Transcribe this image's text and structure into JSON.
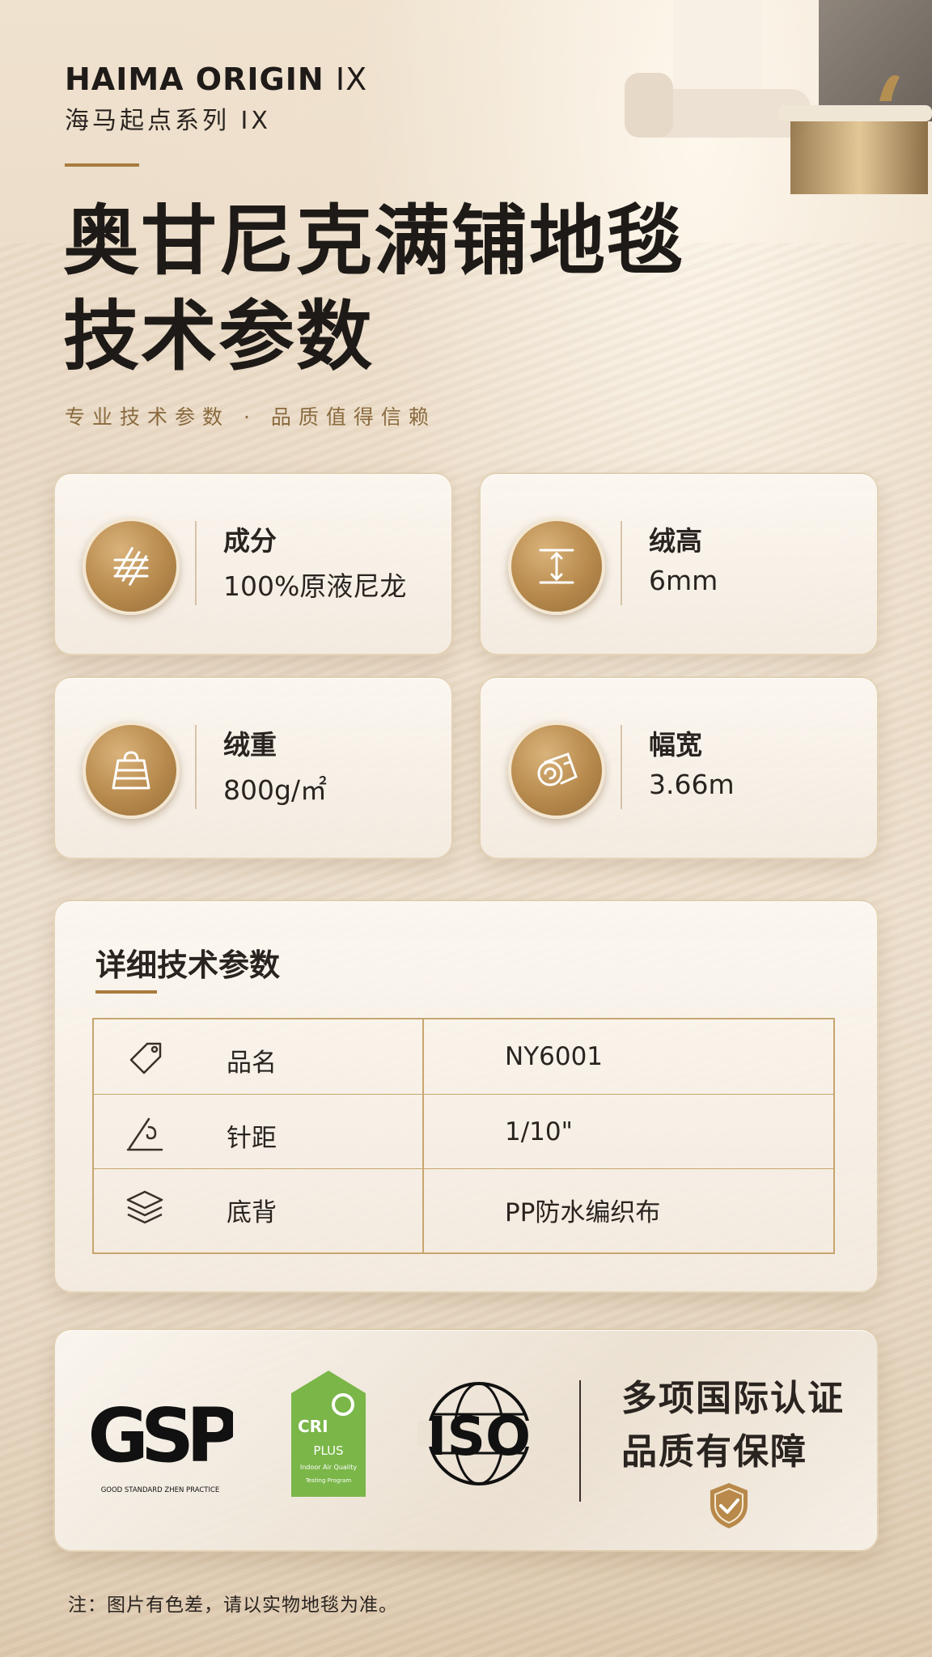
{
  "brand": {
    "name_en": "HAIMA ORIGIN",
    "series_suffix": "IX",
    "name_cn": "海马起点系列 IX"
  },
  "title": {
    "line1": "奥甘尼克满铺地毯",
    "line2": "技术参数"
  },
  "subtitle": "专业技术参数 · 品质值得信赖",
  "specs": [
    {
      "label": "成分",
      "value": "100%原液尼龙",
      "icon": "fiber-weave-icon"
    },
    {
      "label": "绒高",
      "value": "6mm",
      "icon": "pile-height-icon"
    },
    {
      "label": "绒重",
      "value": "800g/㎡",
      "icon": "weight-icon"
    },
    {
      "label": "幅宽",
      "value": "3.66m",
      "icon": "carpet-roll-icon"
    }
  ],
  "details": {
    "title": "详细技术参数",
    "rows": [
      {
        "label": "品名",
        "value": "NY6001",
        "icon": "tag-icon"
      },
      {
        "label": "针距",
        "value": "1/10\"",
        "icon": "needle-thread-icon"
      },
      {
        "label": "底背",
        "value": "PP防水编织布",
        "icon": "layers-icon"
      }
    ]
  },
  "certifications": {
    "logos": [
      "GSP",
      "CRI Green Label Plus",
      "ISO"
    ],
    "line1": "多项国际认证",
    "line2": "品质有保障"
  },
  "footnote": "注：图片有色差，请以实物地毯为准。",
  "colors": {
    "accent_gold": "#a87b3e",
    "text_dark": "#2a2420",
    "cri_green": "#7ab648"
  }
}
